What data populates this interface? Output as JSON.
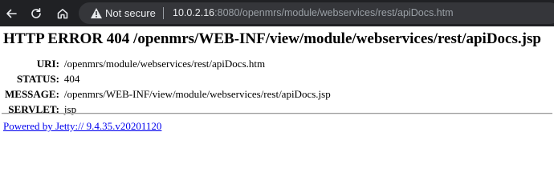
{
  "browser": {
    "security_label": "Not secure",
    "url_host": "10.0.2.16",
    "url_rest": ":8080/openmrs/module/webservices/rest/apiDocs.htm",
    "icons": {
      "back": "back-arrow-icon",
      "reload": "reload-icon",
      "home": "home-icon",
      "warning": "warning-triangle-icon"
    },
    "colors": {
      "toolbar": "#202124",
      "omnibox": "#35363a",
      "text": "#e8eaed",
      "text_dim": "#9aa0a6"
    }
  },
  "page": {
    "title": "HTTP ERROR 404 /openmrs/WEB-INF/view/module/webservices/rest/apiDocs.jsp",
    "rows": [
      {
        "label": "URI:",
        "value": "/openmrs/module/webservices/rest/apiDocs.htm"
      },
      {
        "label": "STATUS:",
        "value": "404"
      },
      {
        "label": "MESSAGE:",
        "value": "/openmrs/WEB-INF/view/module/webservices/rest/apiDocs.jsp"
      },
      {
        "label": "SERVLET:",
        "value": "jsp"
      }
    ],
    "footer_link": "Powered by Jetty:// 9.4.35.v20201120",
    "colors": {
      "link": "#0000ee"
    }
  }
}
